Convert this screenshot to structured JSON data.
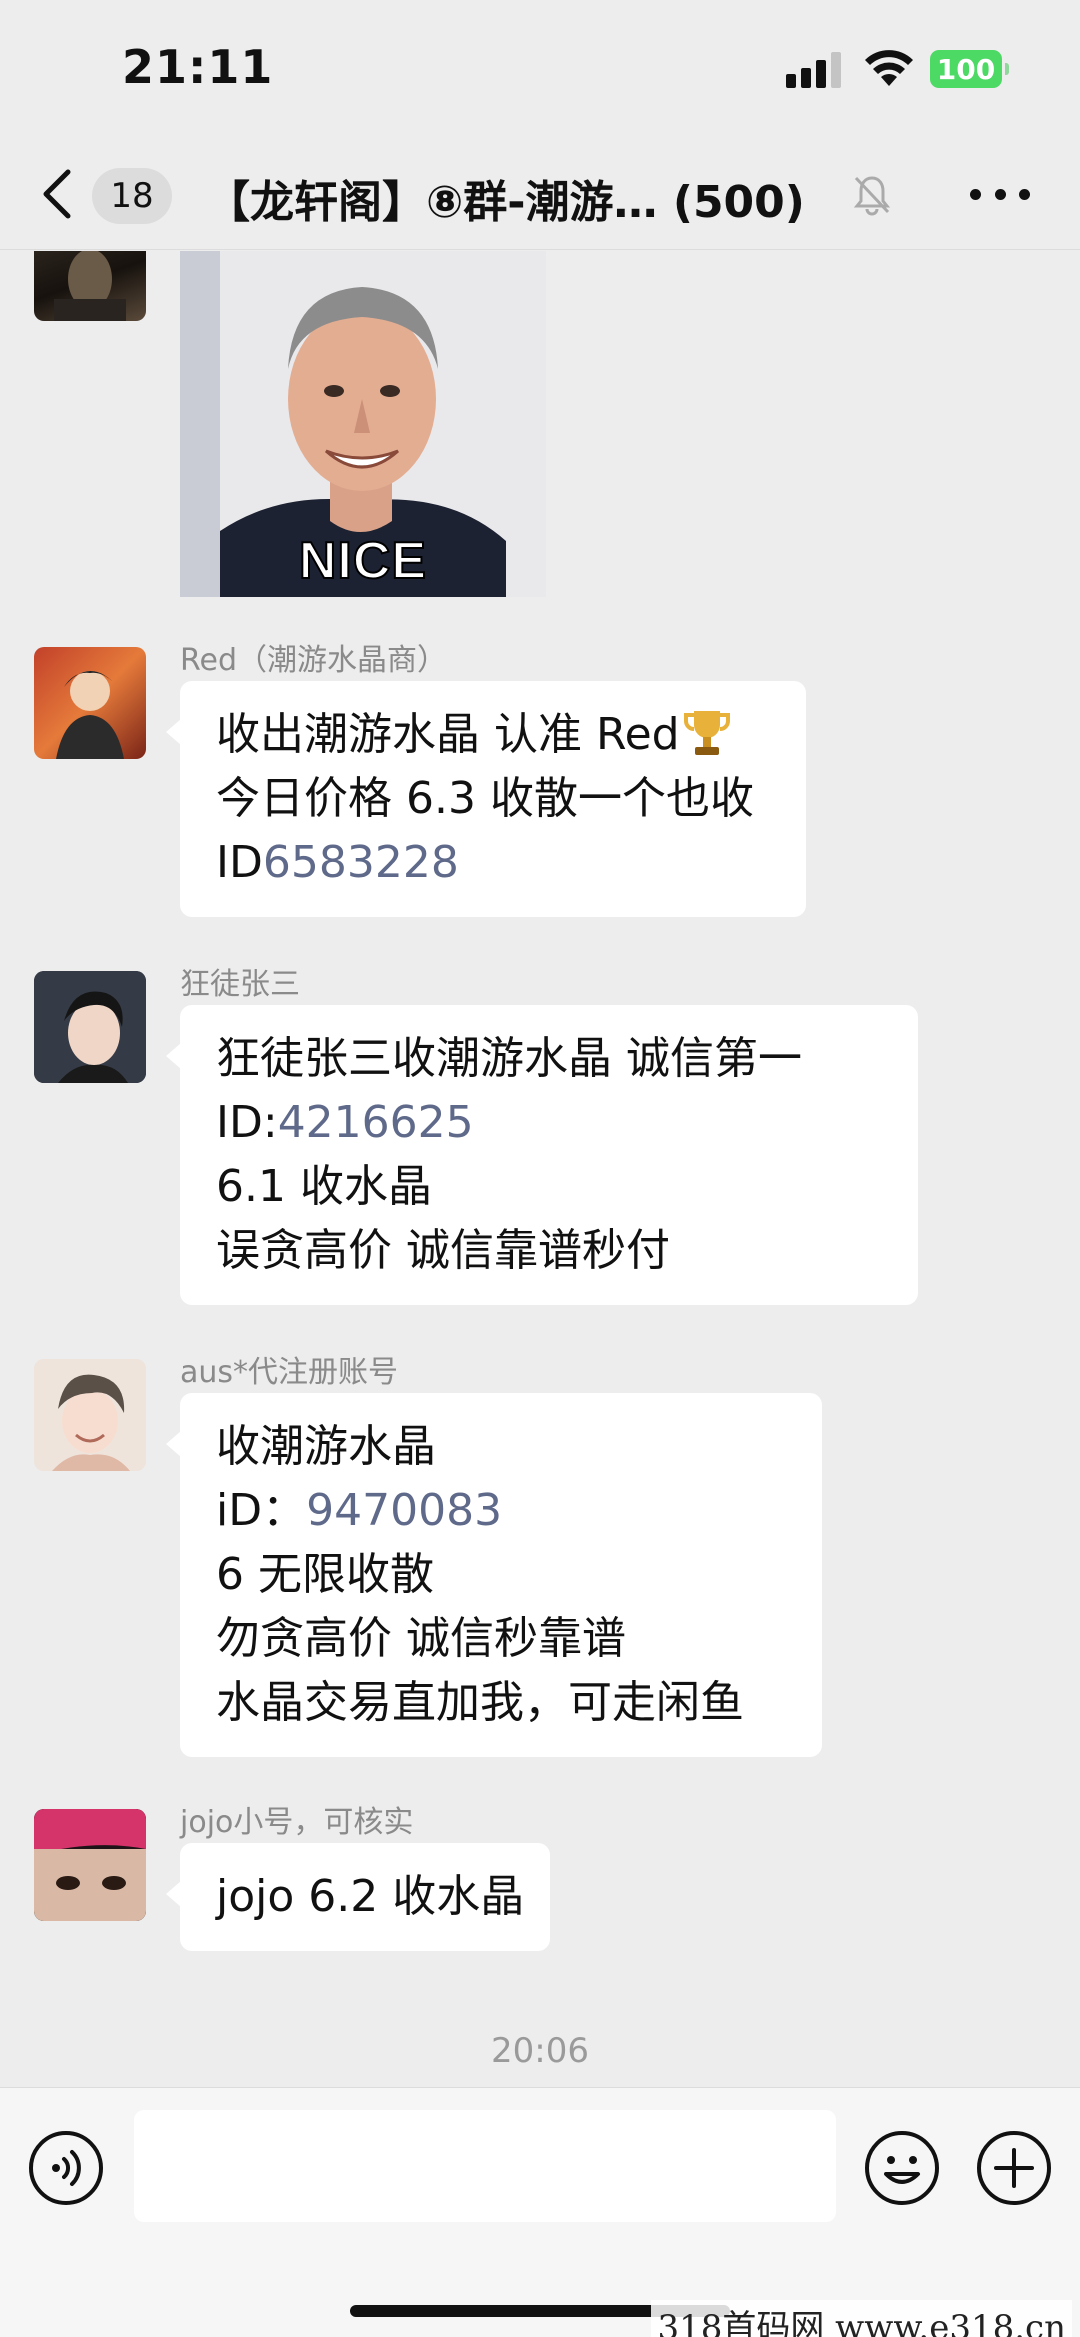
{
  "status_bar": {
    "time": "21:11",
    "battery": "100",
    "battery_color": "#4cd964"
  },
  "nav": {
    "back_icon": "chevron-left-icon",
    "unread_count": "18",
    "title": "【龙轩阁】⑧群-潮游… (500)",
    "mute_icon": "bell-off-icon",
    "more_icon": "more-dots-icon"
  },
  "messages": [
    {
      "type": "image",
      "meme_caption": "NICE"
    },
    {
      "sender": "Red（潮游水晶商）",
      "lines": [
        {
          "text": "收出潮游水晶 认准 Red",
          "suffix_icon": "trophy-icon"
        },
        {
          "text": "今日价格 6.3 收散一个也收"
        },
        {
          "prefix": "ID",
          "link": "6583228"
        }
      ]
    },
    {
      "sender": "狂徒张三",
      "lines": [
        {
          "text": "狂徒张三收潮游水晶 诚信第一"
        },
        {
          "prefix": "ID:",
          "link": "4216625"
        },
        {
          "text": "6.1 收水晶"
        },
        {
          "text": "误贪高价 诚信靠谱秒付"
        }
      ]
    },
    {
      "sender": "aus*代注册账号",
      "lines": [
        {
          "text": "收潮游水晶"
        },
        {
          "prefix": "iD：",
          "link": "9470083"
        },
        {
          "text": "6 无限收散"
        },
        {
          "text": "勿贪高价 诚信秒靠谱"
        },
        {
          "text": "水晶交易直加我，可走闲鱼"
        }
      ]
    },
    {
      "sender": "jojo小号，可核实",
      "lines": [
        {
          "text": "jojo 6.2 收水晶"
        }
      ]
    }
  ],
  "timestamp": "20:06",
  "input_bar": {
    "voice_icon": "voice-icon",
    "emoji_icon": "emoji-icon",
    "plus_icon": "plus-circle-icon"
  },
  "watermark": "318首码网 www.e318.cn",
  "colors": {
    "background": "#ededed",
    "bubble": "#ffffff",
    "id_link": "#5f6a8a",
    "sender": "#8a8a8a"
  }
}
